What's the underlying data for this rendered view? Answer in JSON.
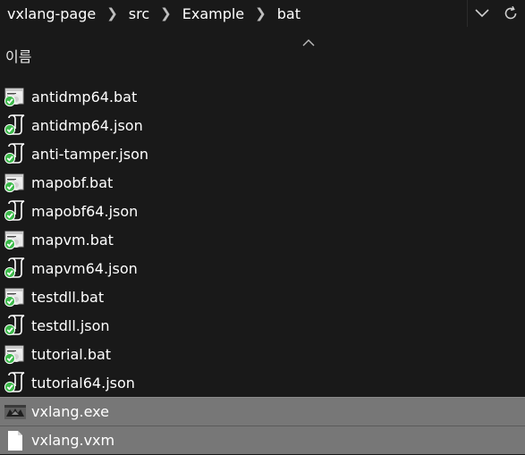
{
  "address": {
    "crumbs": [
      "vxlang-page",
      "src",
      "Example",
      "bat"
    ]
  },
  "header": {
    "column_name": "이름",
    "sort": "ascending"
  },
  "files": [
    {
      "name": "antidmp64.bat",
      "icon": "batch-file-icon",
      "selected": false
    },
    {
      "name": "antidmp64.json",
      "icon": "json-file-icon",
      "selected": false
    },
    {
      "name": "anti-tamper.json",
      "icon": "json-file-icon",
      "selected": false
    },
    {
      "name": "mapobf.bat",
      "icon": "batch-file-icon",
      "selected": false
    },
    {
      "name": "mapobf64.json",
      "icon": "json-file-icon",
      "selected": false
    },
    {
      "name": "mapvm.bat",
      "icon": "batch-file-icon",
      "selected": false
    },
    {
      "name": "mapvm64.json",
      "icon": "json-file-icon",
      "selected": false
    },
    {
      "name": "testdll.bat",
      "icon": "batch-file-icon",
      "selected": false
    },
    {
      "name": "testdll.json",
      "icon": "json-file-icon",
      "selected": false
    },
    {
      "name": "tutorial.bat",
      "icon": "batch-file-icon",
      "selected": false
    },
    {
      "name": "tutorial64.json",
      "icon": "json-file-icon",
      "selected": false
    },
    {
      "name": "vxlang.exe",
      "icon": "exe-file-icon",
      "selected": true
    },
    {
      "name": "vxlang.vxm",
      "icon": "blank-file-icon",
      "selected": true
    }
  ],
  "colors": {
    "background": "#191919",
    "selected_row": "#777777",
    "check_green": "#3cba4a"
  }
}
